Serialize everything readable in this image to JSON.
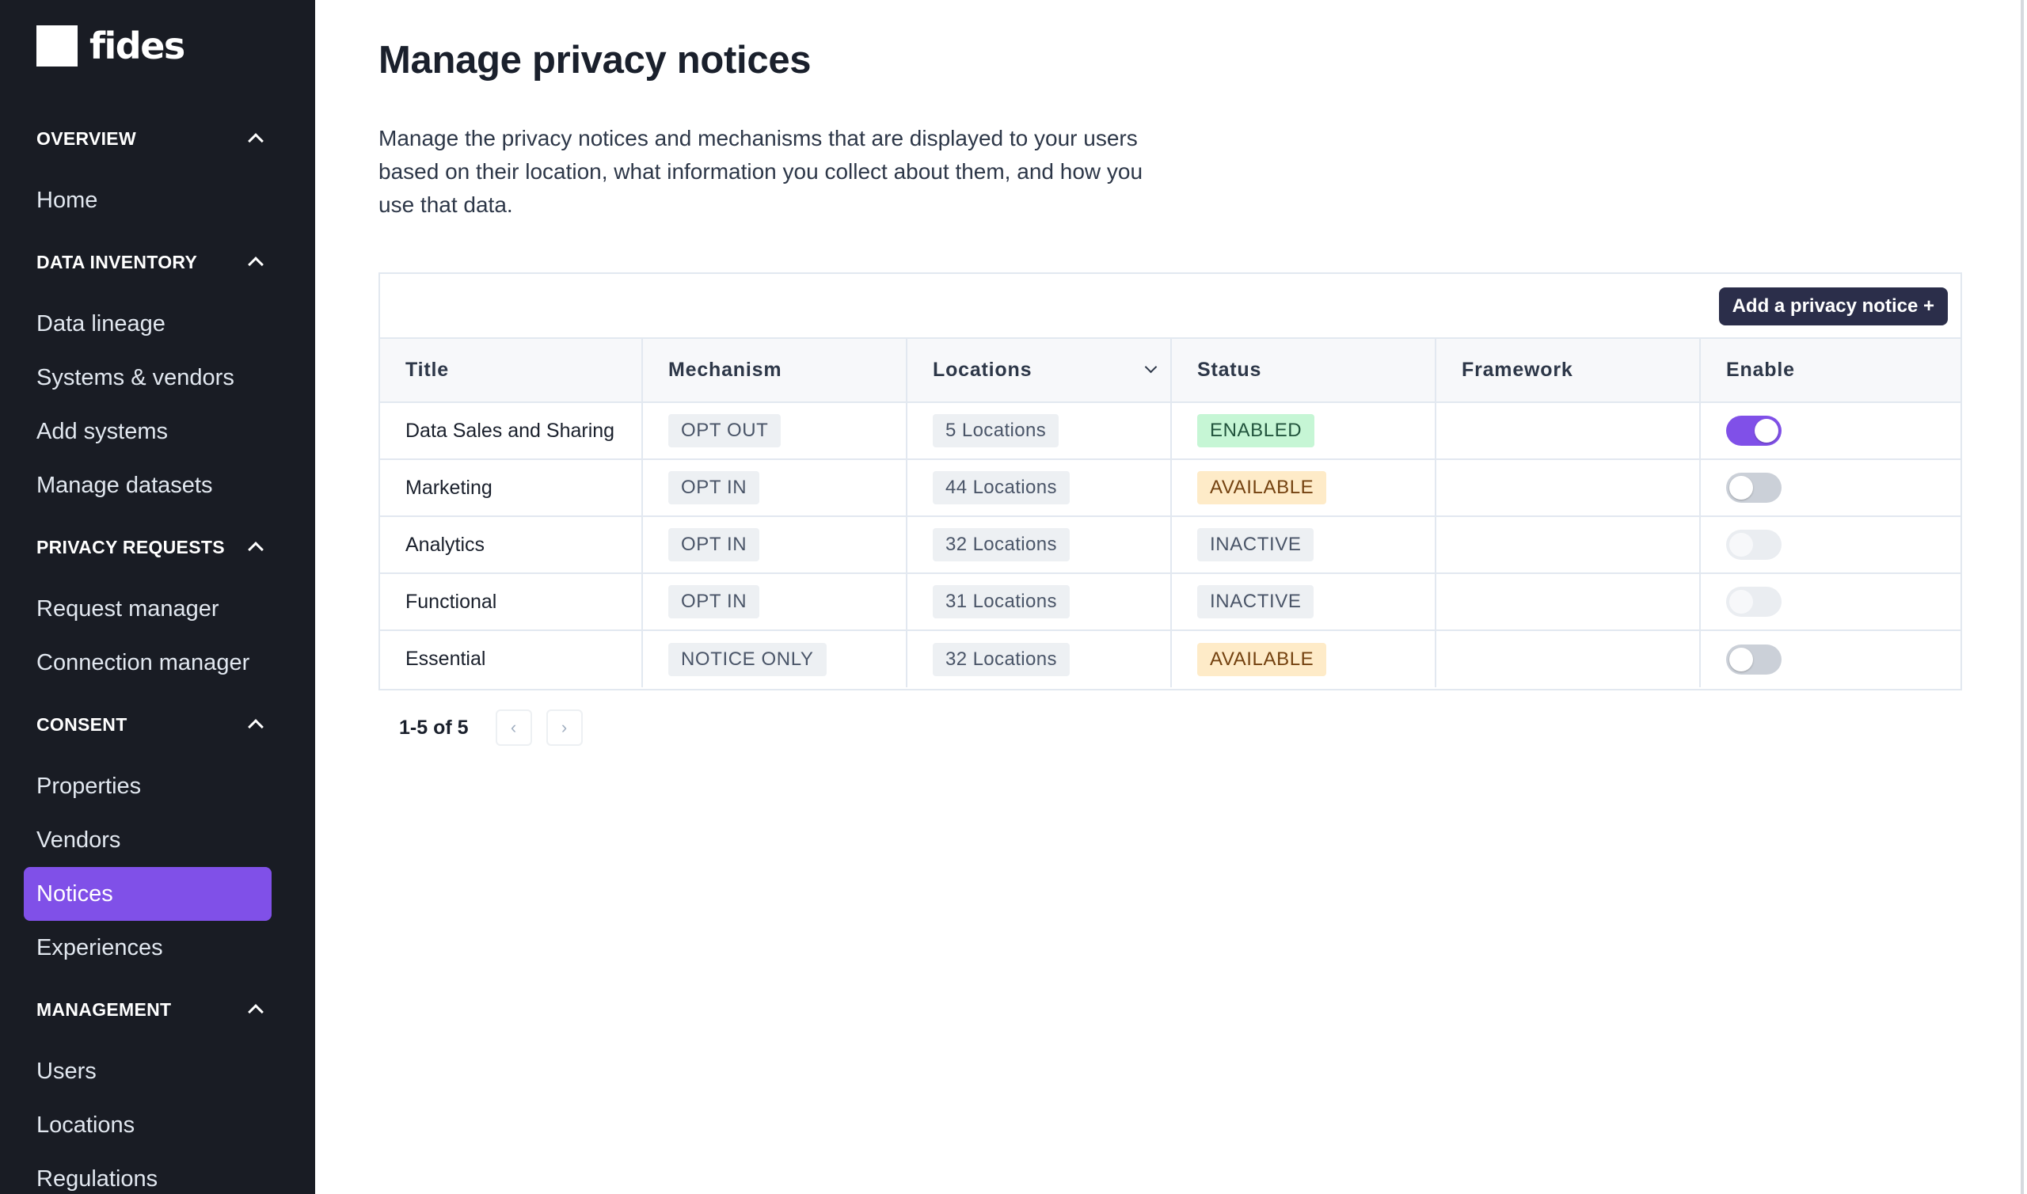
{
  "brand": {
    "name": "fides"
  },
  "sidebar": {
    "groups": [
      {
        "title": "OVERVIEW",
        "items": [
          "Home"
        ]
      },
      {
        "title": "DATA INVENTORY",
        "items": [
          "Data lineage",
          "Systems & vendors",
          "Add systems",
          "Manage datasets"
        ]
      },
      {
        "title": "PRIVACY REQUESTS",
        "items": [
          "Request manager",
          "Connection manager"
        ]
      },
      {
        "title": "CONSENT",
        "items": [
          "Properties",
          "Vendors",
          "Notices",
          "Experiences"
        ]
      },
      {
        "title": "MANAGEMENT",
        "items": [
          "Users",
          "Locations",
          "Regulations"
        ]
      }
    ],
    "active_item": "Notices"
  },
  "page": {
    "title": "Manage privacy notices",
    "description": "Manage the privacy notices and mechanisms that are displayed to your users based on their location, what information you collect about them, and how you use that data."
  },
  "toolbar": {
    "add_label": "Add a privacy notice +"
  },
  "table": {
    "headers": [
      "Title",
      "Mechanism",
      "Locations",
      "Status",
      "Framework",
      "Enable"
    ],
    "rows": [
      {
        "title": "Data Sales and Sharing",
        "mechanism": "OPT OUT",
        "locations": "5 Locations",
        "status": "ENABLED",
        "framework": "",
        "enabled": true,
        "toggle_state": "on"
      },
      {
        "title": "Marketing",
        "mechanism": "OPT IN",
        "locations": "44 Locations",
        "status": "AVAILABLE",
        "framework": "",
        "enabled": false,
        "toggle_state": "off"
      },
      {
        "title": "Analytics",
        "mechanism": "OPT IN",
        "locations": "32 Locations",
        "status": "INACTIVE",
        "framework": "",
        "enabled": false,
        "toggle_state": "disabled"
      },
      {
        "title": "Functional",
        "mechanism": "OPT IN",
        "locations": "31 Locations",
        "status": "INACTIVE",
        "framework": "",
        "enabled": false,
        "toggle_state": "disabled"
      },
      {
        "title": "Essential",
        "mechanism": "NOTICE ONLY",
        "locations": "32 Locations",
        "status": "AVAILABLE",
        "framework": "",
        "enabled": false,
        "toggle_state": "off"
      }
    ]
  },
  "pagination": {
    "label": "1-5 of 5",
    "prev_icon": "‹",
    "next_icon": "›"
  },
  "colors": {
    "sidebar_bg": "#191c24",
    "accent": "#8050e8",
    "button_bg": "#2b2e4a",
    "status_enabled_bg": "#c6f6d5",
    "status_available_bg": "#feebc8",
    "status_inactive_bg": "#edf0f3"
  }
}
